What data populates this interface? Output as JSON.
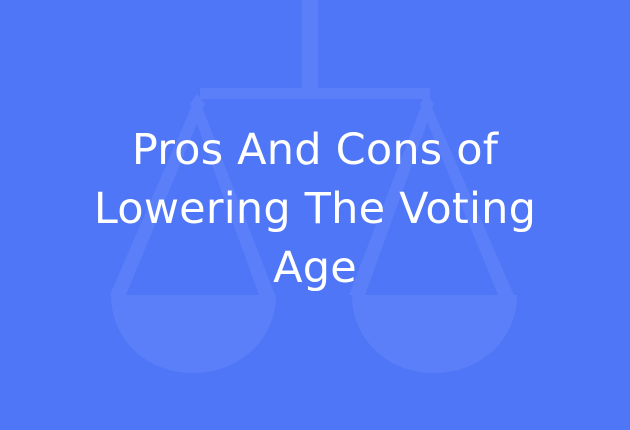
{
  "background": {
    "color": "#4f76f6",
    "icon": "balance-scale-icon",
    "icon_color": "#6b8cff"
  },
  "title": {
    "lines": [
      "Pros And Cons of",
      "Lowering The Voting",
      "Age"
    ],
    "color": "#ffffff"
  }
}
